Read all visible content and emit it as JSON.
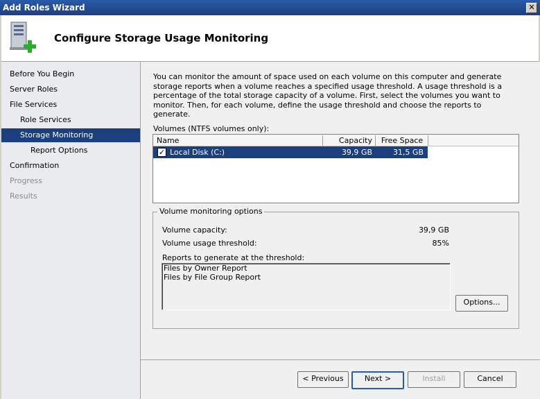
{
  "window": {
    "title": "Add Roles Wizard",
    "close_glyph": "✕"
  },
  "header": {
    "title": "Configure Storage Usage Monitoring",
    "icon": "server-add-icon"
  },
  "nav": {
    "items": [
      {
        "label": "Before You Begin",
        "state": "normal"
      },
      {
        "label": "Server Roles",
        "state": "normal"
      },
      {
        "label": "File Services",
        "state": "normal"
      },
      {
        "label": "Role Services",
        "state": "normal"
      },
      {
        "label": "Storage Monitoring",
        "state": "selected"
      },
      {
        "label": "Report Options",
        "state": "normal"
      },
      {
        "label": "Confirmation",
        "state": "normal"
      },
      {
        "label": "Progress",
        "state": "disabled"
      },
      {
        "label": "Results",
        "state": "disabled"
      }
    ]
  },
  "main": {
    "intro": "You can monitor the amount of space used on each volume on this computer and generate storage reports when a volume reaches a specified usage threshold.  A usage threshold is a percentage of the total storage capacity of a volume. First, select the volumes you want to monitor.  Then, for each volume, define the usage threshold and choose the reports to generate.",
    "volumes_label": "Volumes (NTFS volumes only):",
    "columns": {
      "name": "Name",
      "capacity": "Capacity",
      "free": "Free Space"
    },
    "volume": {
      "checked": "✓",
      "name": "Local Disk (C:)",
      "capacity": "39,9 GB",
      "free": "31,5 GB"
    },
    "options": {
      "legend": "Volume monitoring options",
      "capacity_label": "Volume capacity:",
      "capacity_value": "39,9 GB",
      "threshold_label": "Volume usage threshold:",
      "threshold_value": "85%",
      "reports_label": "Reports to generate at the threshold:",
      "reports": [
        "Files by Owner Report",
        "Files by File Group Report"
      ],
      "options_button": "Options..."
    }
  },
  "buttons": {
    "previous": "< Previous",
    "next": "Next >",
    "install": "Install",
    "cancel": "Cancel"
  },
  "colors": {
    "selection": "#1c3f80",
    "titlebar": "#2a5aa8"
  }
}
